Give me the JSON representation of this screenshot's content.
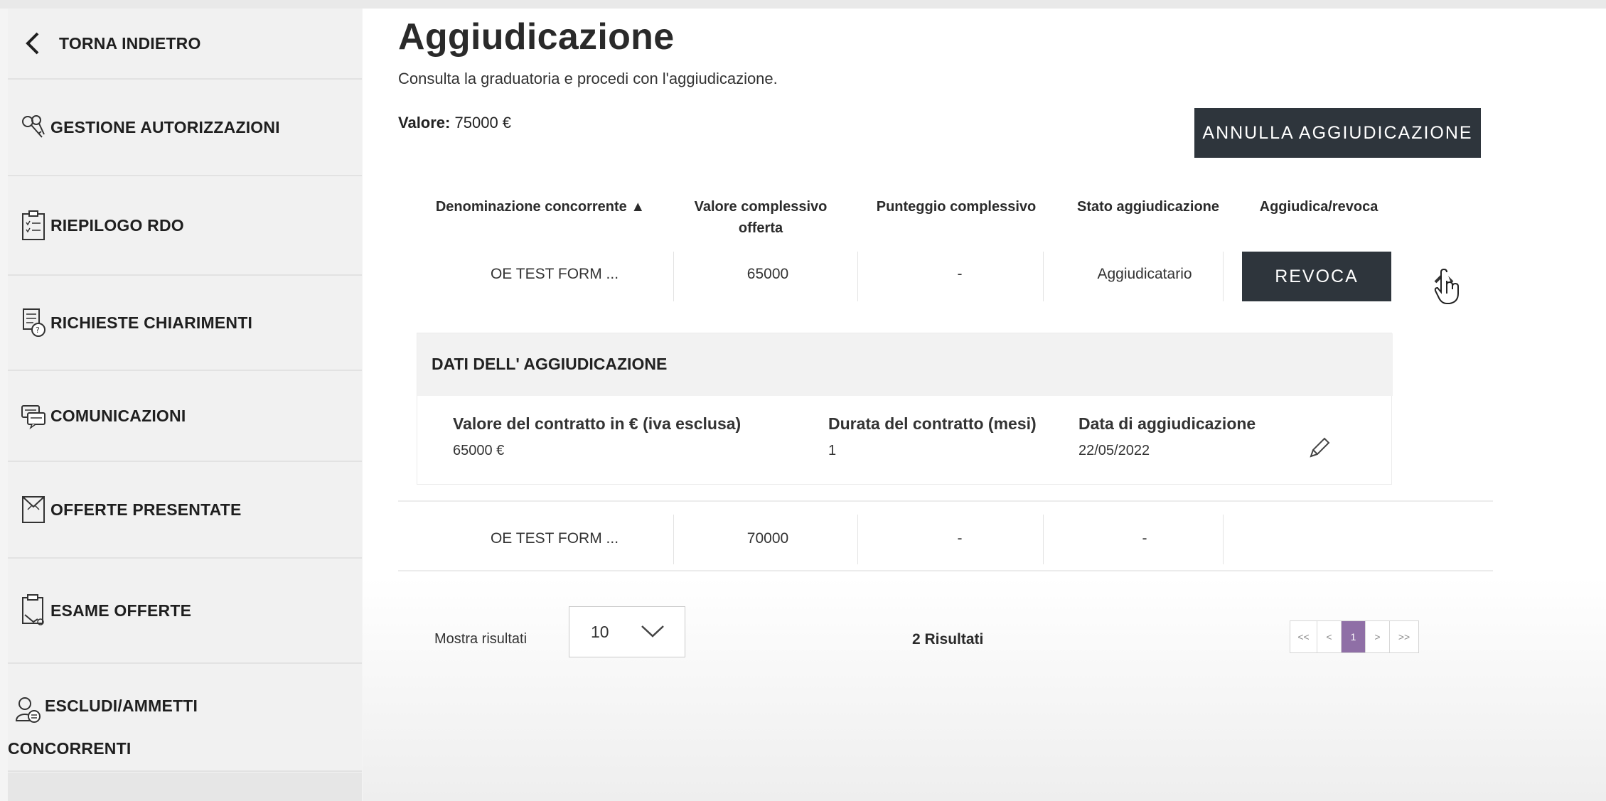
{
  "sidebar": {
    "back_label": "TORNA INDIETRO",
    "items": [
      {
        "label": "GESTIONE AUTORIZZAZIONI",
        "icon": "keys-icon"
      },
      {
        "label": "RIEPILOGO RDO",
        "icon": "clipboard-icon"
      },
      {
        "label": "RICHIESTE CHIARIMENTI",
        "icon": "documents-question-icon"
      },
      {
        "label": "COMUNICAZIONI",
        "icon": "chat-bubbles-icon"
      },
      {
        "label": "OFFERTE PRESENTATE",
        "icon": "envelope-offer-icon"
      },
      {
        "label": "ESAME OFFERTE",
        "icon": "document-exam-icon"
      },
      {
        "label_line1": "ESCLUDI/AMMETTI",
        "label_line2": "CONCORRENTI",
        "icon": "user-switch-icon"
      }
    ]
  },
  "main": {
    "title": "Aggiudicazione",
    "subtitle": "Consulta la graduatoria e procedi con l'aggiudicazione.",
    "valore_label": "Valore:",
    "valore_value": "75000 €",
    "annulla_button": "ANNULLA AGGIUDICAZIONE"
  },
  "table": {
    "headers": {
      "denominazione": "Denominazione concorrente ▲",
      "valore_line1": "Valore complessivo",
      "valore_line2": "offerta",
      "punteggio": "Punteggio complessivo",
      "stato": "Stato aggiudicazione",
      "aggiudica": "Aggiudica/revoca"
    },
    "rows": [
      {
        "name": "OE TEST FORM ...",
        "valore": "65000",
        "punteggio": "-",
        "stato": "Aggiudicatario",
        "action": "REVOCA"
      },
      {
        "name": "OE TEST FORM ...",
        "valore": "70000",
        "punteggio": "-",
        "stato": "-"
      }
    ]
  },
  "detail": {
    "title": "DATI DELL' AGGIUDICAZIONE",
    "contratto_label": "Valore del contratto in € (iva esclusa)",
    "contratto_value": "65000 €",
    "durata_label": "Durata del contratto (mesi)",
    "durata_value": "1",
    "data_label": "Data di aggiudicazione",
    "data_value": "22/05/2022"
  },
  "footer": {
    "mostra_label": "Mostra risultati",
    "page_size": "10",
    "risultati": "2 Risultati",
    "pager": {
      "first": "<<",
      "prev": "<",
      "current": "1",
      "next": ">",
      "last": ">>"
    }
  },
  "colors": {
    "dark_button": "#2e353c",
    "pager_active": "#8f6fa6",
    "sidebar_bg": "#f1f1f1"
  }
}
